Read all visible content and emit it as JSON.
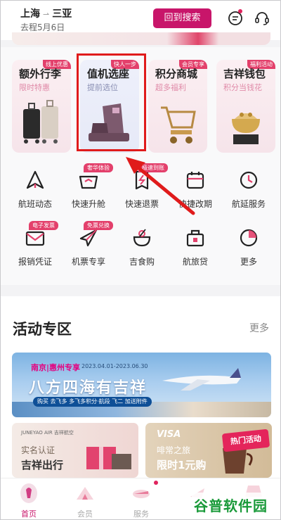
{
  "header": {
    "origin": "上海",
    "destination": "三亚",
    "date": "去程5月6日",
    "back_button": "回到搜索"
  },
  "features": [
    {
      "title": "额外行李",
      "subtitle": "限时特惠",
      "tag": "线上优惠"
    },
    {
      "title": "值机选座",
      "subtitle": "提前选位",
      "tag": "快人一步"
    },
    {
      "title": "积分商城",
      "subtitle": "超多福利",
      "tag": "会员专享"
    },
    {
      "title": "吉祥钱包",
      "subtitle": "积分当钱花",
      "tag": "福利活动"
    }
  ],
  "services": [
    {
      "label": "航班动态",
      "icon": "flight-status-icon"
    },
    {
      "label": "快速升舱",
      "icon": "upgrade-basket-icon",
      "badge": "奢华体验"
    },
    {
      "label": "快速退票",
      "icon": "refund-ticket-icon",
      "badge": "极速到账"
    },
    {
      "label": "快捷改期",
      "icon": "calendar-icon"
    },
    {
      "label": "航延服务",
      "icon": "delay-clock-icon"
    },
    {
      "label": "报销凭证",
      "icon": "invoice-envelope-icon",
      "badge": "电子发票"
    },
    {
      "label": "机票专享",
      "icon": "airplane-icon",
      "badge": "免票兑换"
    },
    {
      "label": "吉食购",
      "icon": "food-bowl-icon"
    },
    {
      "label": "航旅贷",
      "icon": "loan-bag-icon"
    },
    {
      "label": "更多",
      "icon": "more-circle-icon"
    }
  ],
  "activities": {
    "title": "活动专区",
    "more": "更多",
    "promo": {
      "place": "南京|惠州专享",
      "dates": "2023.04.01-2023.06.30",
      "slogan": "八方四海有吉祥",
      "pill": "购买 去飞多 多飞多积分·航段 飞二 加送附件"
    },
    "card1": {
      "brand": "JUNEYAO AIR 吉祥航空",
      "line1": "实名认证",
      "line2": "吉祥出行"
    },
    "card2": {
      "brand": "VISA",
      "line1": "啡常之旅",
      "line2": "限时1元购"
    },
    "hot_tag": "热门活动"
  },
  "tabbar": [
    {
      "label": "首页",
      "icon": "home-icon"
    },
    {
      "label": "会员",
      "icon": "member-tent-icon"
    },
    {
      "label": "服务",
      "icon": "service-plane-icon"
    },
    {
      "label": "",
      "icon": "trip-icon"
    },
    {
      "label": "",
      "icon": "mine-icon"
    }
  ],
  "watermark": "谷普软件园",
  "colors": {
    "brand": "#c8156a",
    "tag": "#e3406b",
    "highlight": "#e01b1b"
  }
}
